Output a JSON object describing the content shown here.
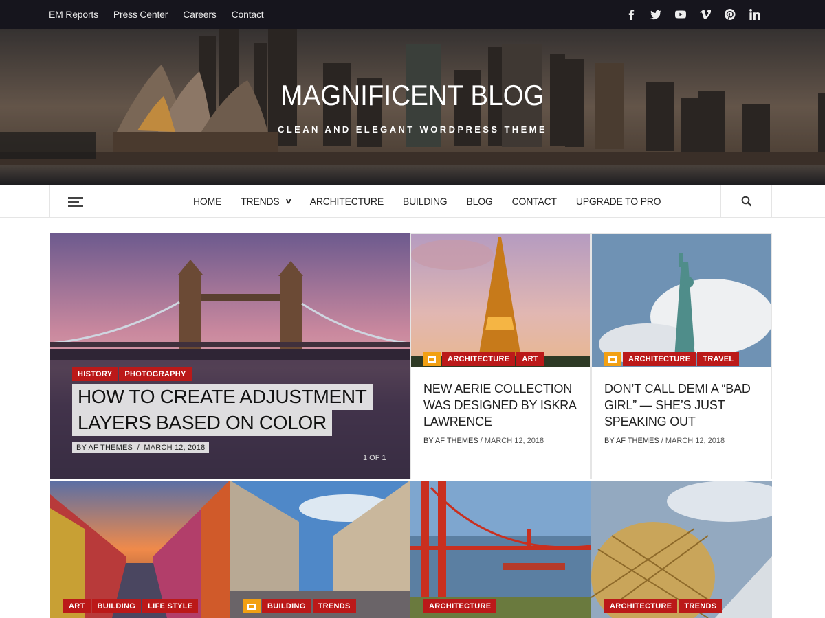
{
  "topbar": {
    "links": [
      "EM Reports",
      "Press Center",
      "Careers",
      "Contact"
    ],
    "social": [
      "facebook-icon",
      "twitter-icon",
      "youtube-icon",
      "vimeo-icon",
      "pinterest-icon",
      "linkedin-icon"
    ]
  },
  "header": {
    "site_title": "MAGNIFICENT BLOG",
    "tagline": "CLEAN AND ELEGANT WORDPRESS THEME"
  },
  "nav": {
    "items": [
      {
        "label": "HOME"
      },
      {
        "label": "TRENDS"
      },
      {
        "label": "ARCHITECTURE"
      },
      {
        "label": "BUILDING"
      },
      {
        "label": "BLOG"
      },
      {
        "label": "CONTACT"
      },
      {
        "label": "UPGRADE TO PRO"
      }
    ],
    "trends_caret": "⌄"
  },
  "featured": {
    "tags": [
      "HISTORY",
      "PHOTOGRAPHY"
    ],
    "title_line1": "HOW TO CREATE ADJUSTMENT",
    "title_line2": "LAYERS BASED ON COLOR",
    "author": "BY AF THEMES",
    "separator": "/",
    "date": "MARCH 12, 2018",
    "pager": "1 OF 1"
  },
  "posts": [
    {
      "tags": [
        "ARCHITECTURE",
        "ART"
      ],
      "title": "NEW AERIE COLLECTION WAS DESIGNED BY ISKRA LAWRENCE",
      "author": "BY AF THEMES",
      "date": "/ MARCH 12, 2018"
    },
    {
      "tags": [
        "ARCHITECTURE",
        "TRAVEL"
      ],
      "title": "DON’T CALL DEMI A “BAD GIRL” — SHE’S JUST SPEAKING OUT",
      "author": "BY AF THEMES",
      "date": "/ MARCH 12, 2018"
    }
  ],
  "bottom_cards": [
    {
      "tags": [
        "ART",
        "BUILDING",
        "LIFE STYLE"
      ]
    },
    {
      "tags": [
        "BUILDING",
        "TRENDS"
      ]
    },
    {
      "tags": [
        "ARCHITECTURE"
      ]
    },
    {
      "tags": [
        "ARCHITECTURE",
        "TRENDS"
      ]
    }
  ],
  "colors": {
    "topbar": "#16151d",
    "tag_red": "#bb1919",
    "format_orange": "#f2a013"
  }
}
